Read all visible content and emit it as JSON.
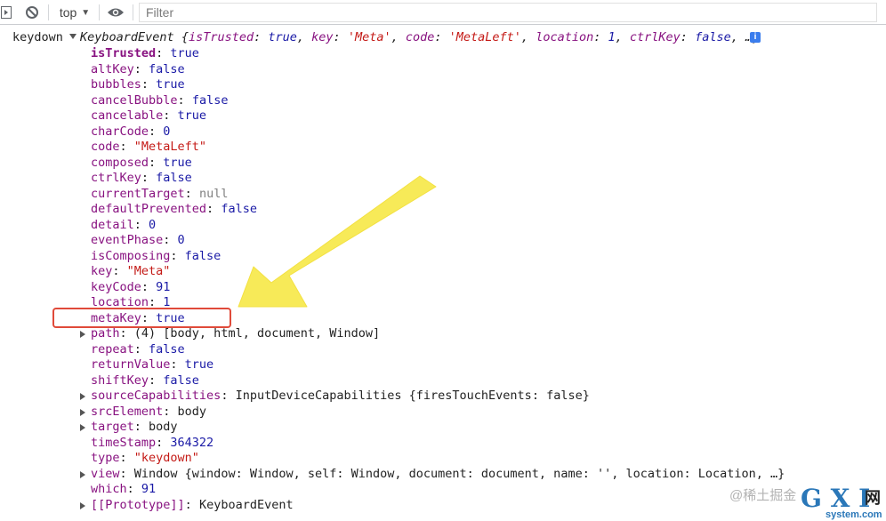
{
  "toolbar": {
    "context": "top",
    "filter_placeholder": "Filter"
  },
  "log": {
    "event_name": "keydown",
    "summary_class": "KeyboardEvent",
    "summary_text": "{isTrusted: true, key: 'Meta', code: 'MetaLeft', location: 1, ctrlKey: false, …}",
    "info_icon": "i"
  },
  "properties": [
    {
      "key": "isTrusted",
      "value": "true",
      "type": "bool",
      "own": true,
      "expandable": false
    },
    {
      "key": "altKey",
      "value": "false",
      "type": "bool",
      "own": false,
      "expandable": false
    },
    {
      "key": "bubbles",
      "value": "true",
      "type": "bool",
      "own": false,
      "expandable": false
    },
    {
      "key": "cancelBubble",
      "value": "false",
      "type": "bool",
      "own": false,
      "expandable": false
    },
    {
      "key": "cancelable",
      "value": "true",
      "type": "bool",
      "own": false,
      "expandable": false
    },
    {
      "key": "charCode",
      "value": "0",
      "type": "num",
      "own": false,
      "expandable": false
    },
    {
      "key": "code",
      "value": "\"MetaLeft\"",
      "type": "str",
      "own": false,
      "expandable": false
    },
    {
      "key": "composed",
      "value": "true",
      "type": "bool",
      "own": false,
      "expandable": false
    },
    {
      "key": "ctrlKey",
      "value": "false",
      "type": "bool",
      "own": false,
      "expandable": false
    },
    {
      "key": "currentTarget",
      "value": "null",
      "type": "null",
      "own": false,
      "expandable": false
    },
    {
      "key": "defaultPrevented",
      "value": "false",
      "type": "bool",
      "own": false,
      "expandable": false
    },
    {
      "key": "detail",
      "value": "0",
      "type": "num",
      "own": false,
      "expandable": false
    },
    {
      "key": "eventPhase",
      "value": "0",
      "type": "num",
      "own": false,
      "expandable": false
    },
    {
      "key": "isComposing",
      "value": "false",
      "type": "bool",
      "own": false,
      "expandable": false
    },
    {
      "key": "key",
      "value": "\"Meta\"",
      "type": "str",
      "own": false,
      "expandable": false
    },
    {
      "key": "keyCode",
      "value": "91",
      "type": "num",
      "own": false,
      "expandable": false
    },
    {
      "key": "location",
      "value": "1",
      "type": "num",
      "own": false,
      "expandable": false
    },
    {
      "key": "metaKey",
      "value": "true",
      "type": "bool",
      "own": false,
      "expandable": false
    },
    {
      "key": "path",
      "value": "(4) [body, html, document, Window]",
      "type": "obj",
      "own": false,
      "expandable": true
    },
    {
      "key": "repeat",
      "value": "false",
      "type": "bool",
      "own": false,
      "expandable": false
    },
    {
      "key": "returnValue",
      "value": "true",
      "type": "bool",
      "own": false,
      "expandable": false
    },
    {
      "key": "shiftKey",
      "value": "false",
      "type": "bool",
      "own": false,
      "expandable": false
    },
    {
      "key": "sourceCapabilities",
      "value": "InputDeviceCapabilities {firesTouchEvents: false}",
      "type": "obj",
      "own": false,
      "expandable": true
    },
    {
      "key": "srcElement",
      "value": "body",
      "type": "obj",
      "own": false,
      "expandable": true
    },
    {
      "key": "target",
      "value": "body",
      "type": "obj",
      "own": false,
      "expandable": true
    },
    {
      "key": "timeStamp",
      "value": "364322",
      "type": "num",
      "own": false,
      "expandable": false
    },
    {
      "key": "type",
      "value": "\"keydown\"",
      "type": "str",
      "own": false,
      "expandable": false
    },
    {
      "key": "view",
      "value": "Window {window: Window, self: Window, document: document, name: '', location: Location, …}",
      "type": "obj",
      "own": false,
      "expandable": true
    },
    {
      "key": "which",
      "value": "91",
      "type": "num",
      "own": false,
      "expandable": false
    },
    {
      "key": "[[Prototype]]",
      "value": "KeyboardEvent",
      "type": "obj",
      "own": false,
      "expandable": true
    }
  ],
  "annotation": {
    "highlighted_property": "metaKey",
    "arrow_color": "#f7e94a",
    "box_color": "#e04a3a"
  },
  "watermark": {
    "text": "@稀土掘金",
    "logo_main": "G X I",
    "logo_cn": "网",
    "logo_sub": "system.com"
  },
  "colors": {
    "key": "#881280",
    "boolean_number": "#1a1aa6",
    "string": "#c41a16",
    "null": "#808080"
  },
  "icons": [
    "sidebar-toggle-icon",
    "clear-console-icon",
    "chevron-down-icon",
    "eye-icon",
    "info-icon",
    "expand-triangle-icon"
  ]
}
